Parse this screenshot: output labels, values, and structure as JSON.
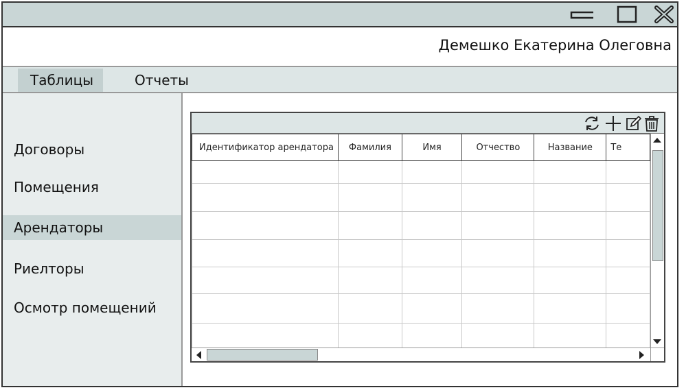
{
  "window": {
    "controls": {
      "minimize_icon": "minimize-icon",
      "maximize_icon": "maximize-icon",
      "close_icon": "close-icon"
    }
  },
  "user": {
    "full_name": "Демешко Екатерина Олеговна"
  },
  "menu": {
    "items": [
      {
        "label": "Таблицы",
        "active": true
      },
      {
        "label": "Отчеты",
        "active": false
      }
    ]
  },
  "sidebar": {
    "items": [
      {
        "label": "Договоры",
        "active": false
      },
      {
        "label": "Помещения",
        "active": false
      },
      {
        "label": "Арендаторы",
        "active": true
      },
      {
        "label": "Риелторы",
        "active": false
      },
      {
        "label": "Осмотр помещений",
        "active": false
      }
    ]
  },
  "grid": {
    "toolbar": {
      "icons": [
        "refresh-icon",
        "add-icon",
        "edit-icon",
        "delete-icon"
      ]
    },
    "columns": [
      "Идентификатор арендатора",
      "Фамилия",
      "Имя",
      "Отчество",
      "Название",
      "Те"
    ],
    "row_count": 7
  },
  "colors": {
    "titlebar": "#c9d6d6",
    "menubar": "#dde6e6",
    "sidebar": "#e8eded",
    "active": "#c9d6d6"
  }
}
